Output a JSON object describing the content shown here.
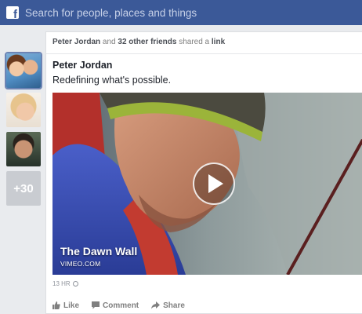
{
  "topbar": {
    "logo": "f",
    "search_placeholder": "Search for people, places and things",
    "color": "#3b5998"
  },
  "sidebar": {
    "avatars": [
      {
        "name": "couple-avatar",
        "selected": true
      },
      {
        "name": "woman-avatar",
        "selected": false
      },
      {
        "name": "man-avatar",
        "selected": false
      }
    ],
    "more_count": "+30"
  },
  "story": {
    "header": {
      "actor": "Peter Jordan",
      "joiner_1": " and ",
      "others": "32 other friends",
      "joiner_2": " shared a ",
      "object": "link"
    },
    "author": "Peter Jordan",
    "message": "Redefining what's possible.",
    "video": {
      "title": "The Dawn Wall",
      "source": "VIMEO.COM",
      "play_icon": "play-icon"
    },
    "timestamp": "13 HR",
    "timestamp_icon": "globe-icon",
    "actions": [
      {
        "label": "Like",
        "icon": "thumbs-up-icon"
      },
      {
        "label": "Comment",
        "icon": "comment-icon"
      },
      {
        "label": "Share",
        "icon": "share-arrow-icon"
      }
    ]
  }
}
